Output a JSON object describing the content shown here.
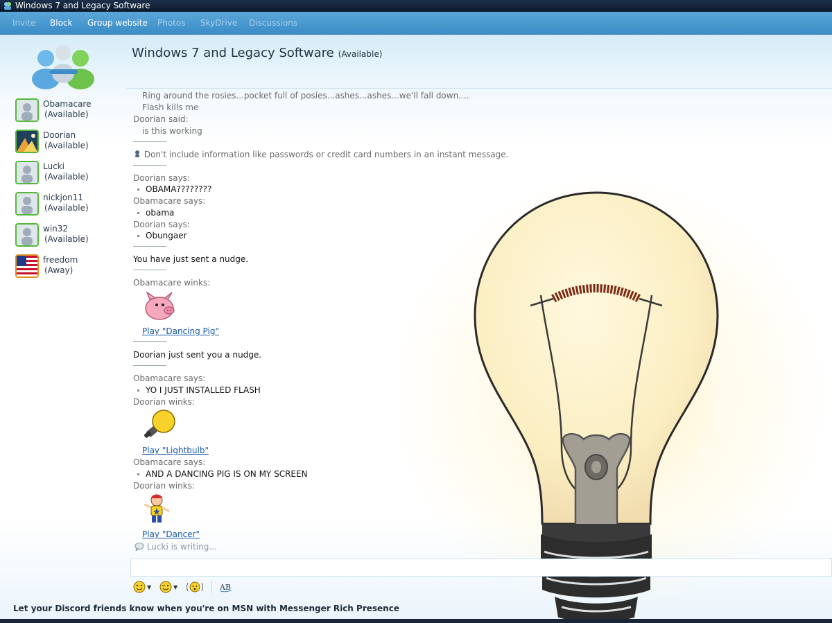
{
  "window": {
    "title": "Windows 7 and Legacy Software"
  },
  "menu": {
    "items": [
      {
        "label": "Invite",
        "enabled": false
      },
      {
        "label": "Block",
        "enabled": true
      },
      {
        "label": "Group website",
        "enabled": true
      },
      {
        "label": "Photos",
        "enabled": false
      },
      {
        "label": "SkyDrive",
        "enabled": false
      },
      {
        "label": "Discussions",
        "enabled": false
      }
    ]
  },
  "header": {
    "title": "Windows 7 and Legacy Software",
    "status": "(Available)"
  },
  "contacts": [
    {
      "name": "Obamacare",
      "status": "(Available)",
      "avatar": "default-user-icon"
    },
    {
      "name": "Doorian",
      "status": "(Available)",
      "avatar": "landscape-avatar-icon"
    },
    {
      "name": "Lucki",
      "status": "(Available)",
      "avatar": "default-user-icon"
    },
    {
      "name": "nickjon11",
      "status": "(Available)",
      "avatar": "default-user-icon"
    },
    {
      "name": "win32",
      "status": "(Available)",
      "avatar": "default-user-icon"
    },
    {
      "name": "freedom",
      "status": "(Away)",
      "avatar": "us-flag-icon"
    }
  ],
  "conversation": {
    "top_partial": "Ring around the rosies...pocket full of posies...ashes...ashes...we'll fall down....",
    "flash_line": "Flash kills me",
    "doorian_said": "Doorian said:",
    "is_working": "is this working",
    "warning": "Don't include information like passwords or credit card numbers in an instant message.",
    "m1_sender": "Doorian says:",
    "m1_text": "OBAMA????????",
    "m2_sender": "Obamacare says:",
    "m2_text": "obama",
    "m3_sender": "Doorian says:",
    "m3_text": "Obungaer",
    "nudge_sent": "You have just sent a nudge.",
    "wink1_sender": "Obamacare winks:",
    "wink1_link": "Play \"Dancing Pig\"",
    "nudge_received": "Doorian just sent you a nudge.",
    "m4_sender": "Obamacare says:",
    "m4_text": "YO I JUST INSTALLED FLASH",
    "wink2_sender": "Doorian winks:",
    "wink2_link": "Play \"Lightbulb\"",
    "m5_sender": "Obamacare says:",
    "m5_text": "AND A DANCING PIG IS ON MY SCREEN",
    "wink3_sender": "Doorian winks:",
    "wink3_link": "Play \"Dancer\""
  },
  "typing": "Lucki is writing...",
  "input": {
    "value": ""
  },
  "toolbar": {
    "icons": [
      "emoticon-icon",
      "wink-icon",
      "nudge-icon",
      "font-icon"
    ]
  },
  "status_bar": "Let your Discord friends know when you're on MSN with Messenger Rich Presence",
  "colors": {
    "menubar": "#3b8cc7",
    "link": "#1a5aa8",
    "available": "#55b83a",
    "away": "#e0901f"
  }
}
